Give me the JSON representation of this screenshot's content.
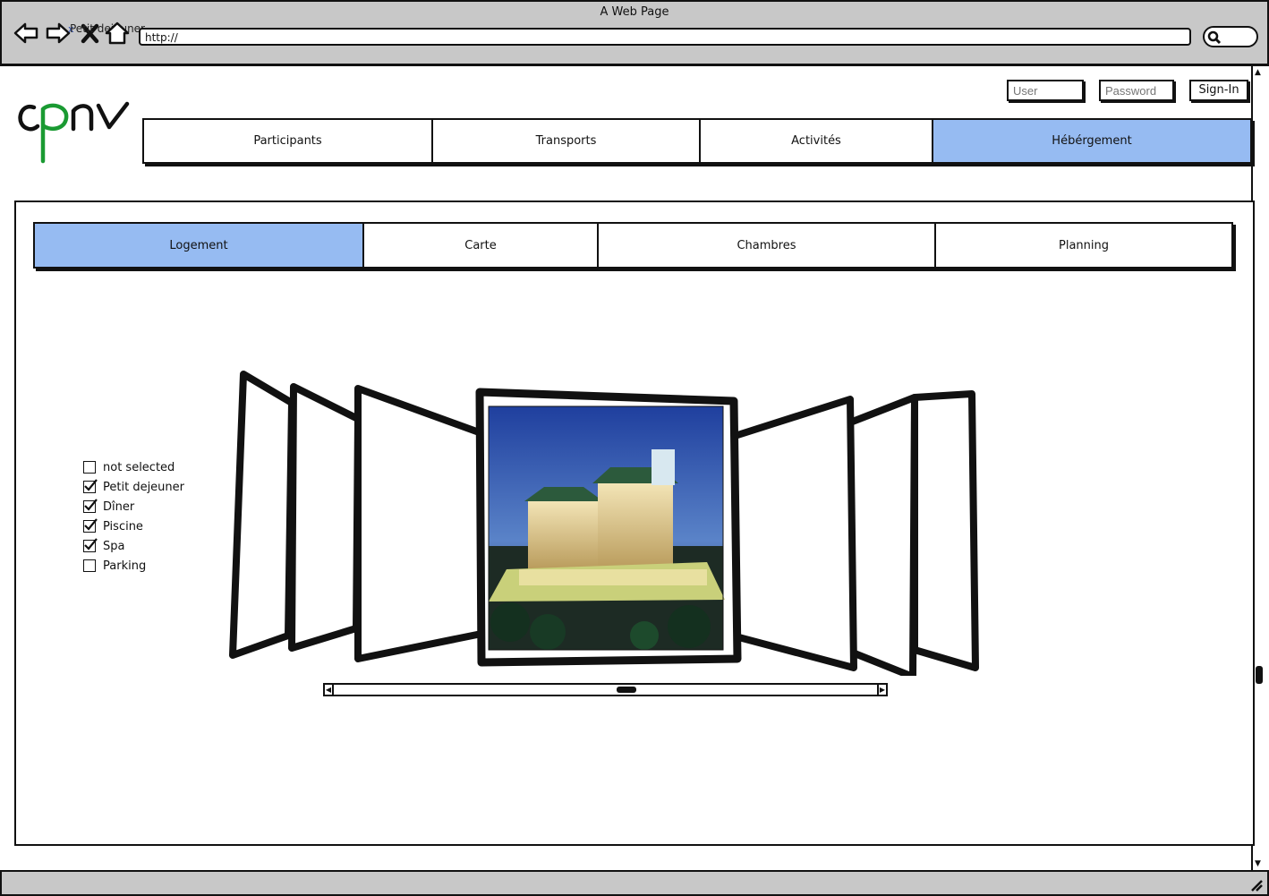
{
  "browser": {
    "window_title": "A Web Page",
    "tab_label": "Petit dejeuner",
    "tab_close": "x",
    "url": "http://"
  },
  "logo": {
    "text": "cpnv"
  },
  "login": {
    "user_placeholder": "User",
    "password_placeholder": "Password",
    "signin_label": "Sign-In"
  },
  "main_nav": {
    "items": [
      {
        "label": "Participants",
        "active": false
      },
      {
        "label": "Transports",
        "active": false
      },
      {
        "label": "Activités",
        "active": false
      },
      {
        "label": "Hébérgement",
        "active": true
      }
    ]
  },
  "sub_nav": {
    "items": [
      {
        "label": "Logement",
        "active": true
      },
      {
        "label": "Carte",
        "active": false
      },
      {
        "label": "Chambres",
        "active": false
      },
      {
        "label": "Planning",
        "active": false
      }
    ]
  },
  "options": [
    {
      "label": "not selected",
      "checked": false
    },
    {
      "label": "Petit dejeuner",
      "checked": true
    },
    {
      "label": "Dîner",
      "checked": true
    },
    {
      "label": "Piscine",
      "checked": true
    },
    {
      "label": "Spa",
      "checked": true
    },
    {
      "label": "Parking",
      "checked": false
    }
  ],
  "carousel": {
    "center_image": "hotel-photo",
    "scroll_position": 0.54
  },
  "colors": {
    "active_tab": "#96bbf2",
    "chrome": "#c8c8c8",
    "logo_green": "#1a9a32"
  }
}
